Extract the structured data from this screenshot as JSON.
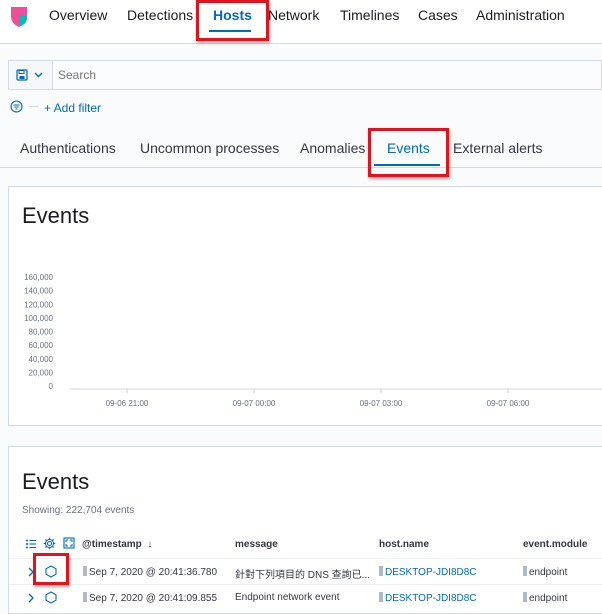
{
  "nav": {
    "items": [
      "Overview",
      "Detections",
      "Hosts",
      "Network",
      "Timelines",
      "Cases",
      "Administration"
    ],
    "active": "Hosts"
  },
  "search": {
    "placeholder": "Search",
    "add_filter": "+ Add filter"
  },
  "tabs": {
    "items": [
      "Authentications",
      "Uncommon processes",
      "Anomalies",
      "Events",
      "External alerts"
    ],
    "active": "Events"
  },
  "histogram": {
    "title": "Events",
    "chart_data": {
      "type": "bar",
      "title": "Events",
      "xlabel": "",
      "ylabel": "",
      "ylim": [
        0,
        160000
      ],
      "yticks": [
        "160,000",
        "140,000",
        "120,000",
        "100,000",
        "80,000",
        "60,000",
        "40,000",
        "20,000",
        "0"
      ],
      "xticks": [
        "09-06 21:00",
        "09-07 00:00",
        "09-07 03:00",
        "09-07 06:00"
      ],
      "grid": false,
      "values": []
    }
  },
  "events_table": {
    "title": "Events",
    "showing": "Showing: 222,704 events",
    "columns": [
      "@timestamp",
      "message",
      "host.name",
      "event.module"
    ],
    "rows": [
      {
        "timestamp": "Sep 7, 2020 @ 20:41:36.780",
        "message": "針對下列項目的 DNS 查詢已...",
        "host": "DESKTOP-JDI8D8C",
        "module": "endpoint"
      },
      {
        "timestamp": "Sep 7, 2020 @ 20:41:09.855",
        "message": "Endpoint network event",
        "host": "DESKTOP-JDI8D8C",
        "module": "endpoint"
      }
    ]
  },
  "colors": {
    "accent": "#006bb8",
    "highlight": "#e0141e",
    "logo": "#f04e98"
  }
}
